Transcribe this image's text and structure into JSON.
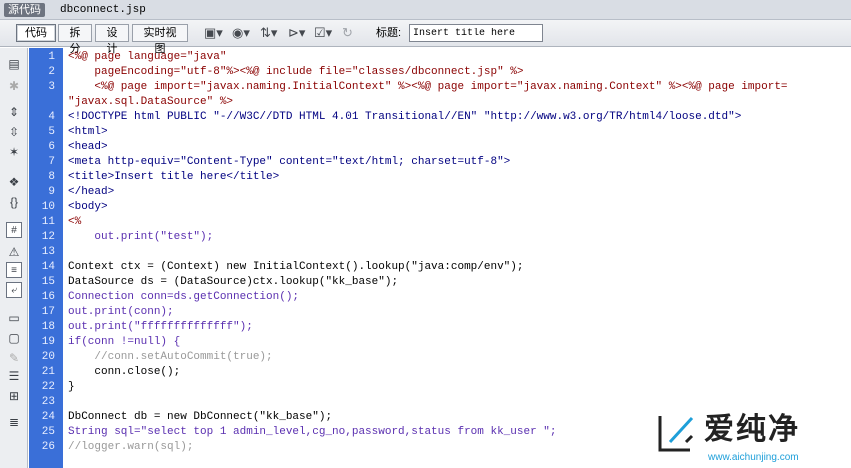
{
  "tabbar": {
    "source_badge": "源代码",
    "file_name": "dbconnect.jsp"
  },
  "toolbar": {
    "views": [
      "代码",
      "拆分",
      "设计",
      "实时视图"
    ],
    "active_view": "代码",
    "title_label": "标题:",
    "title_value": "Insert title here",
    "icons": [
      "multiscreen-icon",
      "preview-globe-icon",
      "file-management-icon",
      "visual-aids-icon",
      "validate-icon",
      "refresh-icon"
    ]
  },
  "leftbar": {
    "icons": [
      "open-documents-icon",
      "show-code-navigator-icon",
      "collapse-full-tag-icon",
      "collapse-selection-icon",
      "expand-all-icon",
      "select-parent-tag-icon",
      "balance-braces-icon",
      "line-numbers-icon",
      "highlight-invalid-code-icon",
      "syntax-coloring-icon",
      "word-wrap-icon",
      "apply-comment-icon",
      "remove-comment-icon",
      "wrap-tag-icon",
      "recent-snippets-icon",
      "move-css-icon",
      "format-source-icon"
    ]
  },
  "editor": {
    "gutter_color": "#3a6fd8",
    "lines": [
      {
        "n": "1",
        "text": "<%@ page language=\"java\""
      },
      {
        "n": "2",
        "text": "    pageEncoding=\"utf-8\"%><%@ include file=\"classes/dbconnect.jsp\" %>"
      },
      {
        "n": "3",
        "text": "    <%@ page import=\"javax.naming.InitialContext\" %><%@ page import=\"javax.naming.Context\" %><%@ page import="
      },
      {
        "n": "",
        "text": "\"javax.sql.DataSource\" %>"
      },
      {
        "n": "4",
        "text": "<!DOCTYPE html PUBLIC \"-//W3C//DTD HTML 4.01 Transitional//EN\" \"http://www.w3.org/TR/html4/loose.dtd\">"
      },
      {
        "n": "5",
        "text": "<html>"
      },
      {
        "n": "6",
        "text": "<head>"
      },
      {
        "n": "7",
        "text": "<meta http-equiv=\"Content-Type\" content=\"text/html; charset=utf-8\">"
      },
      {
        "n": "8",
        "text": "<title>Insert title here</title>"
      },
      {
        "n": "9",
        "text": "</head>"
      },
      {
        "n": "10",
        "text": "<body>"
      },
      {
        "n": "11",
        "text": "<%"
      },
      {
        "n": "12",
        "text": "    out.print(\"test\");"
      },
      {
        "n": "13",
        "text": ""
      },
      {
        "n": "14",
        "text": "Context ctx = (Context) new InitialContext().lookup(\"java:comp/env\");"
      },
      {
        "n": "15",
        "text": "DataSource ds = (DataSource)ctx.lookup(\"kk_base\");"
      },
      {
        "n": "16",
        "text": "Connection conn=ds.getConnection();"
      },
      {
        "n": "17",
        "text": "out.print(conn);"
      },
      {
        "n": "18",
        "text": "out.print(\"ffffffffffffff\");"
      },
      {
        "n": "19",
        "text": "if(conn !=null) {"
      },
      {
        "n": "20",
        "text": "    //conn.setAutoCommit(true);"
      },
      {
        "n": "21",
        "text": "    conn.close();"
      },
      {
        "n": "22",
        "text": "}"
      },
      {
        "n": "23",
        "text": ""
      },
      {
        "n": "24",
        "text": "DbConnect db = new DbConnect(\"kk_base\");"
      },
      {
        "n": "25",
        "text": "String sql=\"select top 1 admin_level,cg_no,password,status from kk_user \";"
      },
      {
        "n": "26",
        "text": "//logger.warn(sql);"
      }
    ]
  },
  "watermark": {
    "brand": "爱纯净",
    "url": "www.aichunjing.com"
  }
}
